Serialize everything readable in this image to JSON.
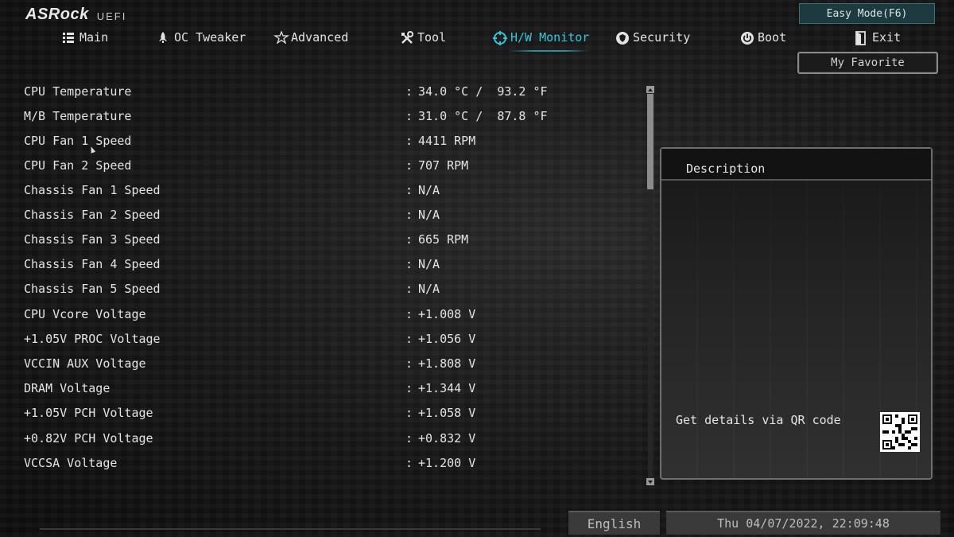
{
  "header": {
    "brand": "ASRock",
    "subtitle": "UEFI",
    "easy_mode_button": "Easy Mode(F6)",
    "my_favorite_button": "My Favorite"
  },
  "nav": {
    "active": "H/W Monitor",
    "items": [
      {
        "label": "Main",
        "icon": "list-icon"
      },
      {
        "label": "OC Tweaker",
        "icon": "rocket-icon"
      },
      {
        "label": "Advanced",
        "icon": "star-icon"
      },
      {
        "label": "Tool",
        "icon": "tools-icon"
      },
      {
        "label": "H/W Monitor",
        "icon": "crosshair-icon"
      },
      {
        "label": "Security",
        "icon": "shield-icon"
      },
      {
        "label": "Boot",
        "icon": "power-icon"
      },
      {
        "label": "Exit",
        "icon": "exit-icon"
      }
    ]
  },
  "monitor": {
    "separator": ":",
    "rows": [
      {
        "label": "CPU Temperature",
        "value": "34.0 °C /  93.2 °F"
      },
      {
        "label": "M/B Temperature",
        "value": "31.0 °C /  87.8 °F"
      },
      {
        "label": "CPU Fan 1 Speed",
        "value": "4411 RPM"
      },
      {
        "label": "CPU Fan 2 Speed",
        "value": "707 RPM"
      },
      {
        "label": "Chassis Fan 1 Speed",
        "value": "N/A"
      },
      {
        "label": "Chassis Fan 2 Speed",
        "value": "N/A"
      },
      {
        "label": "Chassis Fan 3 Speed",
        "value": "665 RPM"
      },
      {
        "label": "Chassis Fan 4 Speed",
        "value": "N/A"
      },
      {
        "label": "Chassis Fan 5 Speed",
        "value": "N/A"
      },
      {
        "label": "CPU Vcore Voltage",
        "value": "+1.008 V"
      },
      {
        "label": "+1.05V PROC Voltage",
        "value": "+1.056 V"
      },
      {
        "label": "VCCIN AUX Voltage",
        "value": "+1.808 V"
      },
      {
        "label": "DRAM Voltage",
        "value": "+1.344 V"
      },
      {
        "label": "+1.05V PCH Voltage",
        "value": "+1.058 V"
      },
      {
        "label": "+0.82V PCH Voltage",
        "value": "+0.832 V"
      },
      {
        "label": "VCCSA Voltage",
        "value": "+1.200 V"
      }
    ]
  },
  "description": {
    "title": "Description",
    "qr_text": "Get details via QR code"
  },
  "footer": {
    "language": "English",
    "datetime": "Thu 04/07/2022, 22:09:48"
  },
  "colors": {
    "accent": "#34c6d8",
    "text": "#e4e4e4",
    "background": "#141414"
  }
}
